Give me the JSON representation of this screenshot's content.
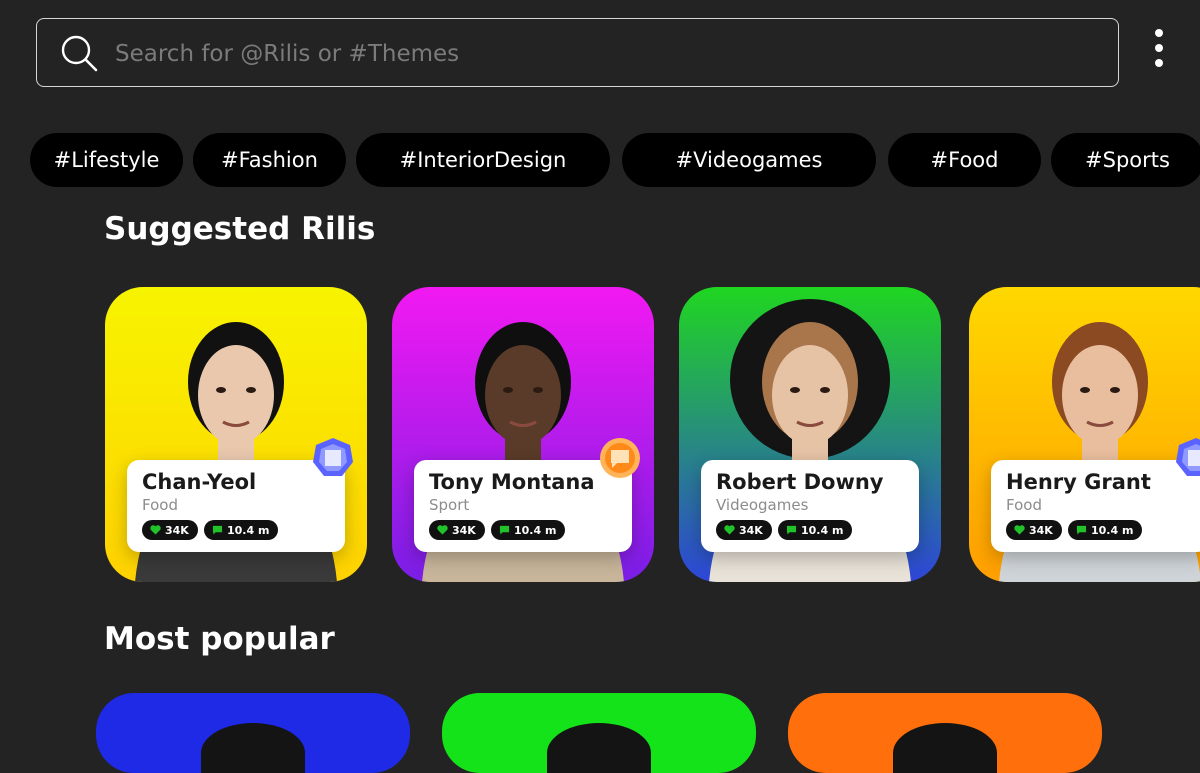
{
  "search": {
    "placeholder": "Search for @Rilis or #Themes"
  },
  "menu": {
    "icon": "kebab-menu-icon"
  },
  "chips": [
    "#Lifestyle",
    "#Fashion",
    "#InteriorDesign",
    "#Videogames",
    "#Food",
    "#Sports"
  ],
  "sections": {
    "suggested_title": "Suggested Rilis",
    "popular_title": "Most popular"
  },
  "suggested": [
    {
      "name": "Chan-Yeol",
      "category": "Food",
      "likes": "34K",
      "comments": "10.4 m",
      "bg": [
        "#f7f400",
        "#ffd200"
      ],
      "badge": "sapphire-gem-icon",
      "shirt": "#3a3a3a",
      "hair": "#111",
      "skin": "#e9c8ae"
    },
    {
      "name": "Tony Montana",
      "category": "Sport",
      "likes": "34K",
      "comments": "10.4 m",
      "bg": [
        "#f219f2",
        "#7a1ee6"
      ],
      "badge": "orange-chat-badge-icon",
      "shirt": "#c8b59a",
      "hair": "#0f0f0f",
      "skin": "#5a3a28"
    },
    {
      "name": "Robert Downy",
      "category": "Videogames",
      "likes": "34K",
      "comments": "10.4 m",
      "bg": [
        "#20d620",
        "#2e46d8"
      ],
      "badge": "",
      "shirt": "#e8e2d8",
      "hair": "#a8764a",
      "skin": "#e7c3a6"
    },
    {
      "name": "Henry Grant",
      "category": "Food",
      "likes": "34K",
      "comments": "10.4 m",
      "bg": [
        "#ffd800",
        "#ff9e00"
      ],
      "badge": "sapphire-gem-icon",
      "shirt": "#cfd4d8",
      "hair": "#8b4a22",
      "skin": "#e9be9e"
    }
  ],
  "popular_colors": [
    "#1f2ae6",
    "#15e31a",
    "#ff6f0b"
  ],
  "colors": {
    "background": "#232323",
    "chip": "#000000",
    "like": "#22c32a",
    "comment": "#22c32a"
  }
}
